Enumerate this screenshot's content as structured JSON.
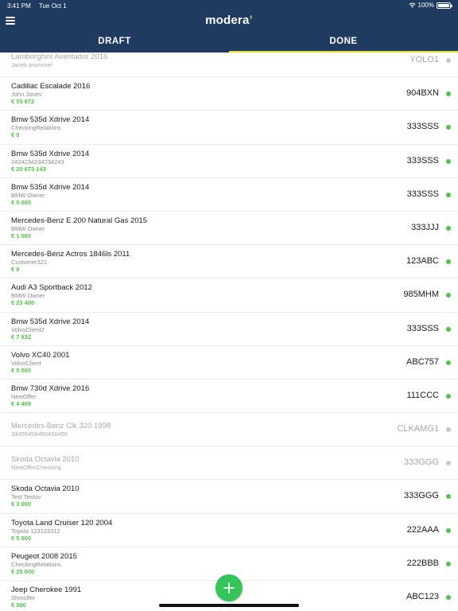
{
  "status_bar": {
    "time": "3:41 PM",
    "date": "Tue Oct 1",
    "battery": "100%"
  },
  "header": {
    "brand": "modera",
    "brand_accent": "#b8d64a",
    "bg_color": "#1f3b5f"
  },
  "tabs": [
    {
      "label": "DRAFT",
      "active": false
    },
    {
      "label": "DONE",
      "active": true
    }
  ],
  "vehicles": [
    {
      "title": "Lamborghini Aventador 2016",
      "owner": "Janek prummel",
      "price": "",
      "plate": "YOLO1",
      "status": "inactive"
    },
    {
      "title": "Cadillac Escalade 2016",
      "owner": "John Jones",
      "price": "€ 55 972",
      "plate": "904BXN",
      "status": "active"
    },
    {
      "title": "Bmw 535d Xdrive 2014",
      "owner": "CheckingRelations",
      "price": "€ 0",
      "plate": "333SSS",
      "status": "active"
    },
    {
      "title": "Bmw 535d Xdrive 2014",
      "owner": "2424234234234243",
      "price": "€ 20 673 143",
      "plate": "333SSS",
      "status": "active"
    },
    {
      "title": "Bmw 535d Xdrive 2014",
      "owner": "BMW Owner",
      "price": "€ 5 000",
      "plate": "333SSS",
      "status": "active"
    },
    {
      "title": "Mercedes-Benz E 200 Natural Gas 2015",
      "owner": "BMW Owner",
      "price": "€ 1 000",
      "plate": "333JJJ",
      "status": "active"
    },
    {
      "title": "Mercedes-Benz Actros 1846ls 2011",
      "owner": "Customer321",
      "price": "€ 0",
      "plate": "123ABC",
      "status": "active"
    },
    {
      "title": "Audi A3 Sportback 2012",
      "owner": "BMW Owner",
      "price": "€ 23 400",
      "plate": "985MHM",
      "status": "active"
    },
    {
      "title": "Bmw 535d Xdrive 2014",
      "owner": "VolvoClient2",
      "price": "€ 7 832",
      "plate": "333SSS",
      "status": "active"
    },
    {
      "title": "Volvo XC40 2001",
      "owner": "VolvoClient",
      "price": "€ 5 000",
      "plate": "ABC757",
      "status": "active"
    },
    {
      "title": "Bmw 730d Xdrive 2016",
      "owner": "NewOffer",
      "price": "€ 4 409",
      "plate": "111CCC",
      "status": "active"
    },
    {
      "title": "Mercedes-Benz Clk 320 1998",
      "owner": "33456456456456456",
      "price": "",
      "plate": "CLKAMG1",
      "status": "inactive"
    },
    {
      "title": "Skoda Octavia 2010",
      "owner": "NewOfferChecking",
      "price": "",
      "plate": "333GGG",
      "status": "inactive"
    },
    {
      "title": "Skoda Octavia 2010",
      "owner": "Test Testov",
      "price": "€ 3 000",
      "plate": "333GGG",
      "status": "active"
    },
    {
      "title": "Toyota Land Cruiser 120 2004",
      "owner": "Toyota 123123312",
      "price": "€ 5 000",
      "plate": "222AAA",
      "status": "active"
    },
    {
      "title": "Peugeot 2008 2015",
      "owner": "CheckingRelations",
      "price": "€ 25 000",
      "plate": "222BBB",
      "status": "active"
    },
    {
      "title": "Jeep Cherokee 1991",
      "owner": "Shmoffer",
      "price": "€ 500",
      "plate": "ABC123",
      "status": "active"
    }
  ],
  "fab": {
    "icon": "plus-icon",
    "color": "#34c45a"
  },
  "colors": {
    "active_dot": "#52c24a",
    "inactive_dot": "#c8c8c8",
    "price": "#52c24a",
    "tab_indicator": "#e9de38"
  }
}
